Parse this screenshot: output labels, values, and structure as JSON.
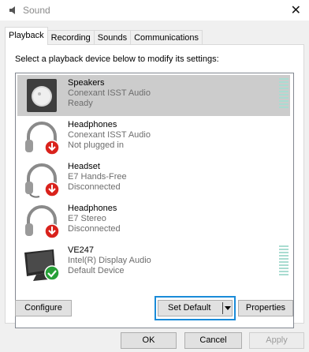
{
  "window": {
    "title": "Sound"
  },
  "tabs": [
    {
      "label": "Playback",
      "active": true
    },
    {
      "label": "Recording",
      "active": false
    },
    {
      "label": "Sounds",
      "active": false
    },
    {
      "label": "Communications",
      "active": false
    }
  ],
  "instruction": "Select a playback device below to modify its settings:",
  "devices": [
    {
      "name": "Speakers",
      "line2": "Conexant ISST Audio",
      "status": "Ready",
      "icon": "speaker-icon",
      "selected": true
    },
    {
      "name": "Headphones",
      "line2": "Conexant ISST Audio",
      "status": "Not plugged in",
      "icon": "headphones-icon",
      "badge": "down-arrow-badge"
    },
    {
      "name": "Headset",
      "line2": "E7 Hands-Free",
      "status": "Disconnected",
      "icon": "headset-icon",
      "badge": "down-arrow-badge"
    },
    {
      "name": "Headphones",
      "line2": "E7 Stereo",
      "status": "Disconnected",
      "icon": "headphones-icon",
      "badge": "down-arrow-badge"
    },
    {
      "name": "VE247",
      "line2": "Intel(R) Display Audio",
      "status": "Default Device",
      "icon": "monitor-icon",
      "badge": "checkmark-badge"
    }
  ],
  "buttons": {
    "configure": "Configure",
    "set_default": "Set Default",
    "properties": "Properties",
    "ok": "OK",
    "cancel": "Cancel",
    "apply": "Apply"
  },
  "colors": {
    "selected_row": "#cccccc",
    "focus": "#1a8bd8",
    "meter": "#a9dcd1",
    "badge_red": "#d9221c",
    "badge_green": "#27a038"
  }
}
